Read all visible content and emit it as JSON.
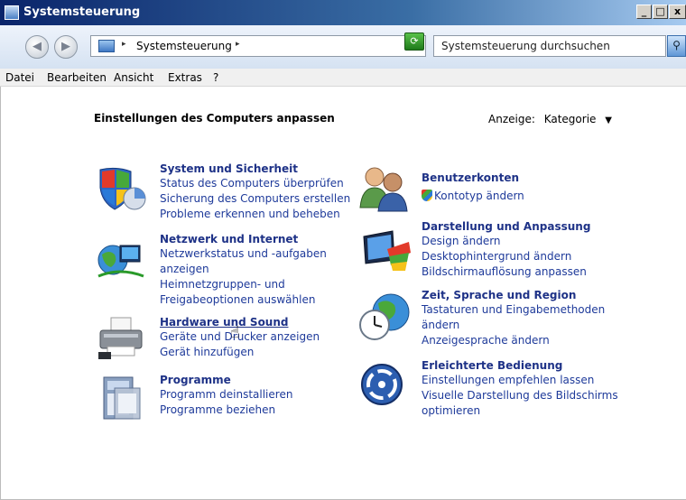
{
  "window": {
    "title": "Systemsteuerung"
  },
  "titlebar_buttons": [
    "_",
    "□",
    "x"
  ],
  "nav": {
    "back_glyph": "◀",
    "forward_glyph": "▶"
  },
  "address": {
    "crumb": "Systemsteuerung",
    "separator": "▸"
  },
  "search": {
    "placeholder": "Systemsteuerung durchsuchen"
  },
  "menu": [
    "Datei",
    "Bearbeiten",
    "Ansicht",
    "Extras",
    "?"
  ],
  "content": {
    "heading": "Einstellungen des Computers anpassen",
    "view_label": "Anzeige:",
    "view_value": "Kategorie",
    "categories": [
      {
        "title": "System und Sicherheit",
        "icon": "shield-icon",
        "links": [
          "Status des Computers überprüfen",
          "Sicherung des Computers erstellen",
          "Probleme erkennen und beheben"
        ]
      },
      {
        "title": "Netzwerk und Internet",
        "icon": "network-globe-icon",
        "links": [
          "Netzwerkstatus und -aufgaben",
          "anzeigen",
          "Heimnetzgruppen- und",
          "Freigabeoptionen auswählen"
        ]
      },
      {
        "title": "Hardware und Sound",
        "icon": "printer-icon",
        "links": [
          "Geräte und Drucker anzeigen",
          "Gerät hinzufügen"
        ]
      },
      {
        "title": "Programme",
        "icon": "programs-icon",
        "links": [
          "Programm deinstallieren",
          "Programme beziehen"
        ]
      },
      {
        "title": "Benutzerkonten",
        "icon": "users-icon",
        "links": [
          "Kontotyp ändern"
        ]
      },
      {
        "title": "Darstellung und Anpassung",
        "icon": "display-icon",
        "links": [
          "Design ändern",
          "Desktophintergrund ändern",
          "Bildschirmauflösung anpassen"
        ]
      },
      {
        "title": "Zeit, Sprache und Region",
        "icon": "clock-globe-icon",
        "links": [
          "Tastaturen und Eingabemethoden",
          "ändern",
          "Anzeigesprache ändern"
        ]
      },
      {
        "title": "Erleichterte Bedienung",
        "icon": "accessibility-icon",
        "links": [
          "Einstellungen empfehlen lassen",
          "Visuelle Darstellung des Bildschirms",
          "optimieren"
        ]
      }
    ]
  }
}
